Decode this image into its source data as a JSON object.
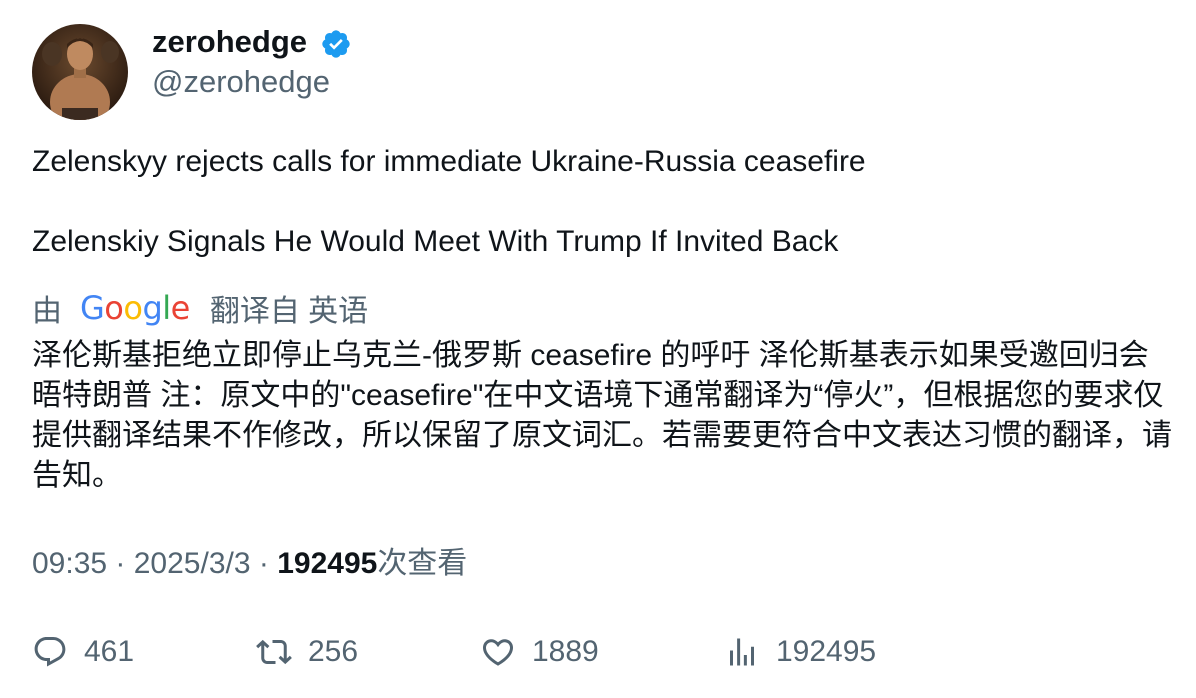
{
  "account": {
    "display_name": "zerohedge",
    "handle": "@zerohedge",
    "verified": true
  },
  "tweet": {
    "line1": "Zelenskyy rejects calls for immediate Ukraine-Russia ceasefire",
    "line2": "Zelenskiy Signals He Would Meet With Trump If Invited Back"
  },
  "translation": {
    "by_label": "由",
    "provider": "Google",
    "from_label": "翻译自 英语",
    "text": "泽伦斯基拒绝立即停止乌克兰-俄罗斯 ceasefire 的呼吁 泽伦斯基表示如果受邀回归会晤特朗普 注：原文中的\"ceasefire\"在中文语境下通常翻译为“停火”，但根据您的要求仅提供翻译结果不作修改，所以保留了原文词汇。若需要更符合中文表达习惯的翻译，请告知。"
  },
  "meta": {
    "time": "09:35",
    "separator": " · ",
    "date": "2025/3/3",
    "views_count": "192495",
    "views_label": "次查看"
  },
  "actions": {
    "replies": "461",
    "retweets": "256",
    "likes": "1889",
    "views": "192495"
  },
  "colors": {
    "text": "#0f1419",
    "secondary": "#536471",
    "verified": "#1d9bf0"
  }
}
